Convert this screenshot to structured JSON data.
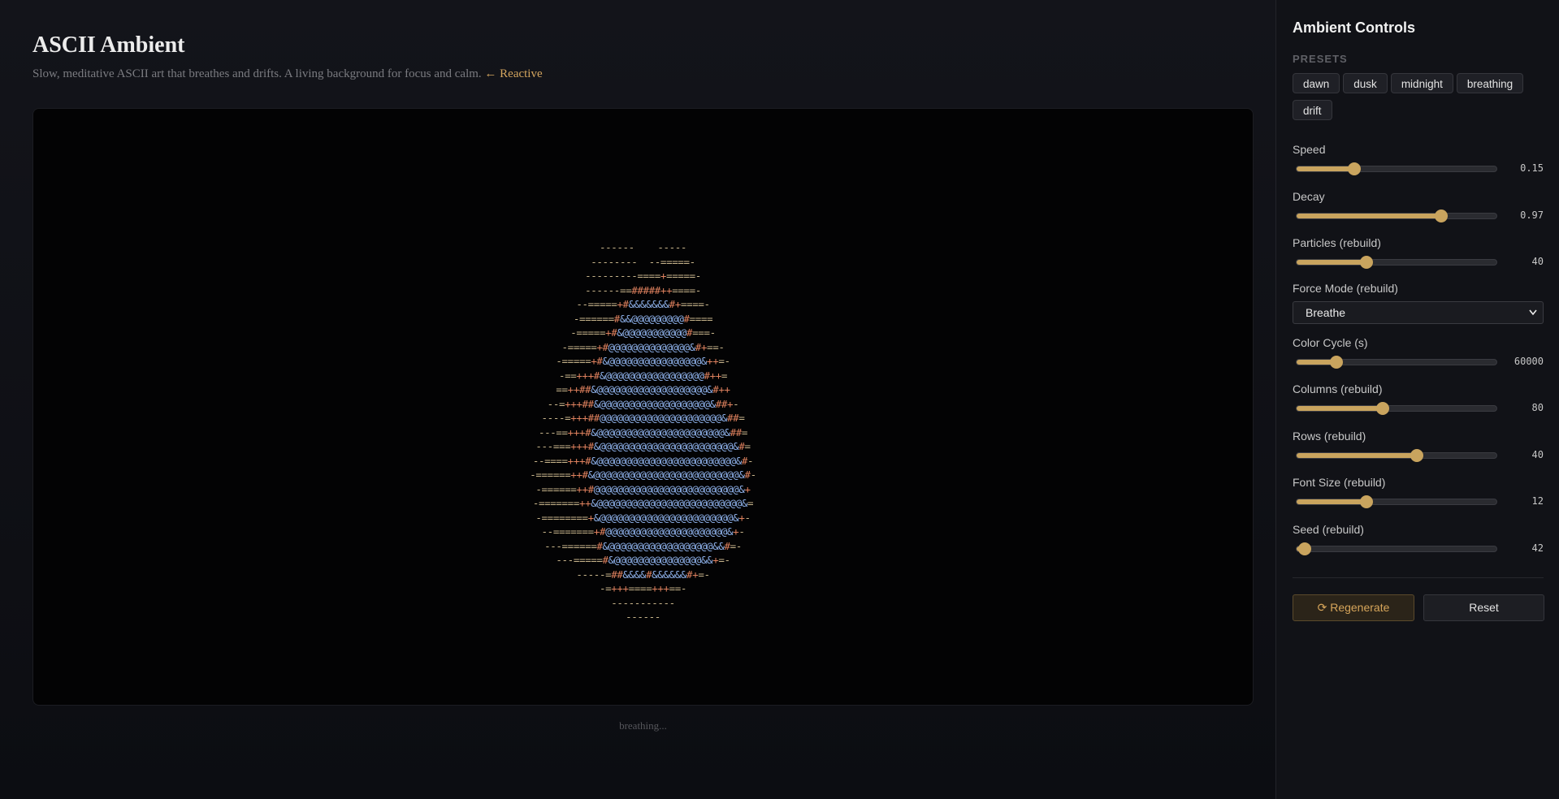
{
  "main": {
    "title": "ASCII Ambient",
    "subtitle": "Slow, meditative ASCII art that breathes and drifts. A living background for focus and calm.",
    "reactive_link": "← Reactive",
    "status": "breathing...",
    "ascii_art": [
      "------    -----",
      "--------  --=====-",
      "---------====+=====-",
      "------==#####++====-",
      "--=====+#&&&&&&&#+====-",
      "-======#&&@@@@@@@@@#====",
      "-=====+#&@@@@@@@@@@@#===-",
      "-=====+#@@@@@@@@@@@@@@&#+==-",
      "-=====+#&@@@@@@@@@@@@@@@@&++=-",
      "-==+++#&@@@@@@@@@@@@@@@@@#++=",
      "==++##&@@@@@@@@@@@@@@@@@@@&#++",
      "--=+++##&@@@@@@@@@@@@@@@@@@@&##+-",
      "----=+++##@@@@@@@@@@@@@@@@@@@@@&##=",
      "---==+++#&@@@@@@@@@@@@@@@@@@@@@@&##=",
      "---===+++#&@@@@@@@@@@@@@@@@@@@@@@@&#=",
      "--====+++#&@@@@@@@@@@@@@@@@@@@@@@@@&#-",
      "-======++#&@@@@@@@@@@@@@@@@@@@@@@@@@&#-",
      "-======++#@@@@@@@@@@@@@@@@@@@@@@@@@&+",
      "-=======++&@@@@@@@@@@@@@@@@@@@@@@@@@&=",
      "-========+&@@@@@@@@@@@@@@@@@@@@@@@&+-",
      "--=======+#@@@@@@@@@@@@@@@@@@@@@&+-",
      "---======#&@@@@@@@@@@@@@@@@@@&&#=-",
      "---=====#&@@@@@@@@@@@@@@@&&+=-",
      "-----=##&&&&#&&&&&&#+=-",
      "-=+++====+++==-",
      "-----------",
      "------"
    ]
  },
  "panel": {
    "title": "Ambient Controls",
    "presets_label": "PRESETS",
    "presets": [
      "dawn",
      "dusk",
      "midnight",
      "breathing",
      "drift"
    ],
    "controls": [
      {
        "label": "Speed",
        "value": "0.15",
        "fraction": 0.29
      },
      {
        "label": "Decay",
        "value": "0.97",
        "fraction": 0.725
      },
      {
        "label": "Particles (rebuild)",
        "value": "40",
        "fraction": 0.35
      },
      {
        "label": "Color Cycle (s)",
        "value": "60000",
        "fraction": 0.2
      },
      {
        "label": "Columns (rebuild)",
        "value": "80",
        "fraction": 0.43
      },
      {
        "label": "Rows (rebuild)",
        "value": "40",
        "fraction": 0.6
      },
      {
        "label": "Font Size (rebuild)",
        "value": "12",
        "fraction": 0.35
      },
      {
        "label": "Seed (rebuild)",
        "value": "42",
        "fraction": 0.04
      }
    ],
    "force_mode": {
      "label": "Force Mode (rebuild)",
      "value": "Breathe"
    },
    "regenerate_label": "⟳ Regenerate",
    "reset_label": "Reset"
  }
}
